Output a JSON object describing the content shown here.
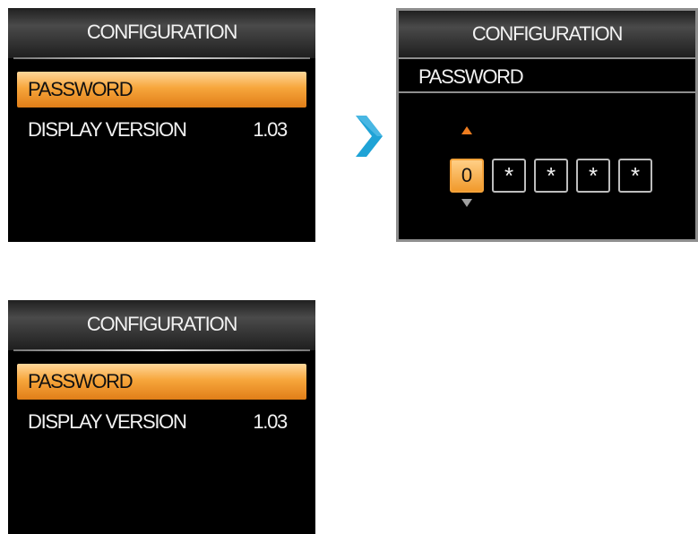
{
  "panel_top_left": {
    "title": "CONFIGURATION",
    "items": [
      {
        "label": "PASSWORD",
        "selected": true
      },
      {
        "label": "DISPLAY VERSION",
        "value": "1.03"
      }
    ]
  },
  "panel_password": {
    "title": "CONFIGURATION",
    "subtitle": "PASSWORD",
    "digits": [
      "0",
      "*",
      "*",
      "*",
      "*"
    ],
    "active_digit_index": 0
  },
  "panel_bottom_left": {
    "title": "CONFIGURATION",
    "items": [
      {
        "label": "PASSWORD",
        "selected": true
      },
      {
        "label": "DISPLAY VERSION",
        "value": "1.03"
      }
    ]
  },
  "icons": {
    "transition_arrow": "chevron-right-icon"
  },
  "colors": {
    "accent": "#f19a2c",
    "arrow": "#1fa3d6",
    "screen": "#000000"
  }
}
